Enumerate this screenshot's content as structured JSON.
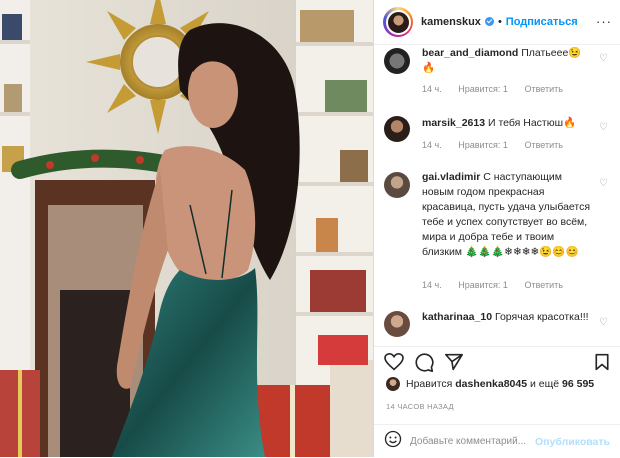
{
  "post": {
    "username": "kamenskux",
    "follow_label": "Подписаться",
    "separator": "•",
    "more_icon": "···"
  },
  "comments": [
    {
      "username": "bear_and_diamond",
      "text": "Платьеее😉🔥",
      "time": "14 ч.",
      "like_label": "Нравится: 1",
      "reply_label": "Ответить"
    },
    {
      "username": "marsik_2613",
      "text": "И тебя Настюш🔥",
      "time": "14 ч.",
      "like_label": "Нравится: 1",
      "reply_label": "Ответить"
    },
    {
      "username": "gai.vladimir",
      "text": "С наступающим новым годом прекрасная красавица, пусть удача улыбается тебе и успех сопутствует во всём, мира и добра тебе и твоим близким 🎄🎄🎄❄❄❄❄😉😊😊",
      "time": "14 ч.",
      "like_label": "Нравится: 1",
      "reply_label": "Ответить"
    },
    {
      "username": "katharinaa_10",
      "text": "Горячая красотка!!!",
      "time": "",
      "like_label": "",
      "reply_label": ""
    }
  ],
  "likes": {
    "prefix": "Нравится",
    "user": "dashenka8045",
    "suffix": "и ещё",
    "count": "96 595"
  },
  "time_ago": "14 ЧАСОВ НАЗАД",
  "add_comment": {
    "placeholder": "Добавьте комментарий...",
    "post_label": "Опубликовать"
  },
  "colors": {
    "link_blue": "#0095f6",
    "muted": "#8e8e8e",
    "post_disabled": "#b2dffc",
    "dress": "#1f5a56"
  },
  "icons": [
    "heart-icon",
    "comment-icon",
    "share-icon",
    "bookmark-icon",
    "smile-icon",
    "verified-icon"
  ]
}
